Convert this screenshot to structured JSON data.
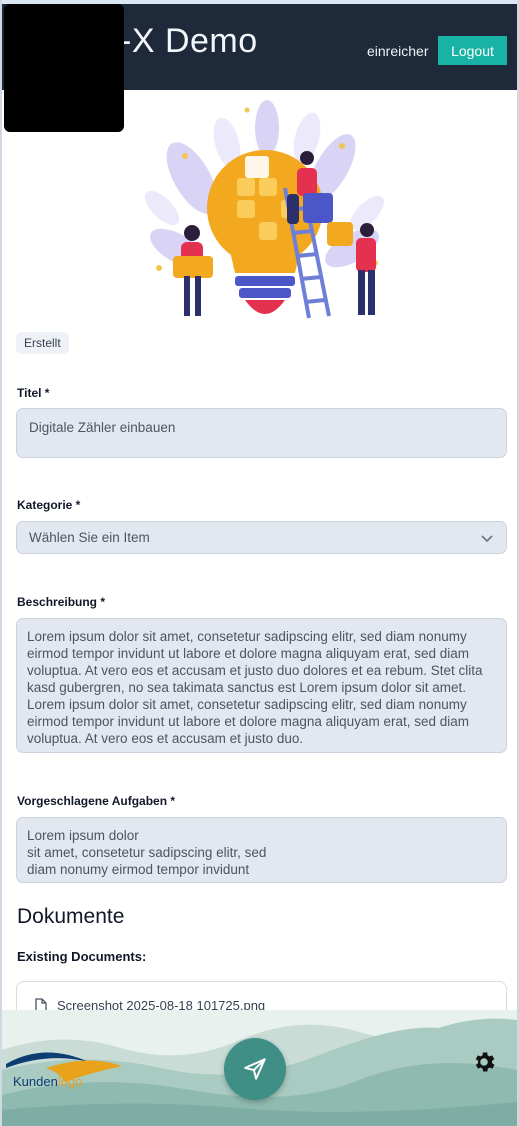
{
  "header": {
    "title": "-X Demo",
    "user": "einreicher",
    "logout_label": "Logout",
    "colors": {
      "bg": "#1e2a3a",
      "logout_bg": "#19b3a6"
    }
  },
  "status": {
    "badge": "Erstellt"
  },
  "form": {
    "title_label": "Titel *",
    "title_value": "Digitale Zähler einbauen",
    "category_label": "Kategorie *",
    "category_placeholder": "Wählen Sie ein Item",
    "description_label": "Beschreibung *",
    "description_value": "Lorem ipsum dolor sit amet, consetetur sadipscing elitr, sed diam nonumy eirmod tempor invidunt ut labore et dolore magna aliquyam erat, sed diam voluptua. At vero eos et accusam et justo duo dolores et ea rebum. Stet clita kasd gubergren, no sea takimata sanctus est Lorem ipsum dolor sit amet. Lorem ipsum dolor sit amet, consetetur sadipscing elitr, sed diam nonumy eirmod tempor invidunt ut labore et dolore magna aliquyam erat, sed diam voluptua. At vero eos et accusam et justo duo.",
    "tasks_label": "Vorgeschlagene Aufgaben *",
    "tasks_value": "Lorem ipsum dolor\nsit amet, consetetur sadipscing elitr, sed\ndiam nonumy eirmod tempor invidunt"
  },
  "documents": {
    "title": "Dokumente",
    "existing_label": "Existing Documents:",
    "files": [
      {
        "name": "Screenshot 2025-08-18 101725.png",
        "icon": "file-icon"
      }
    ]
  },
  "footer": {
    "brand_part1": "Kunden",
    "brand_part2": "logo",
    "send_icon": "send-icon",
    "settings_icon": "gear-icon"
  }
}
